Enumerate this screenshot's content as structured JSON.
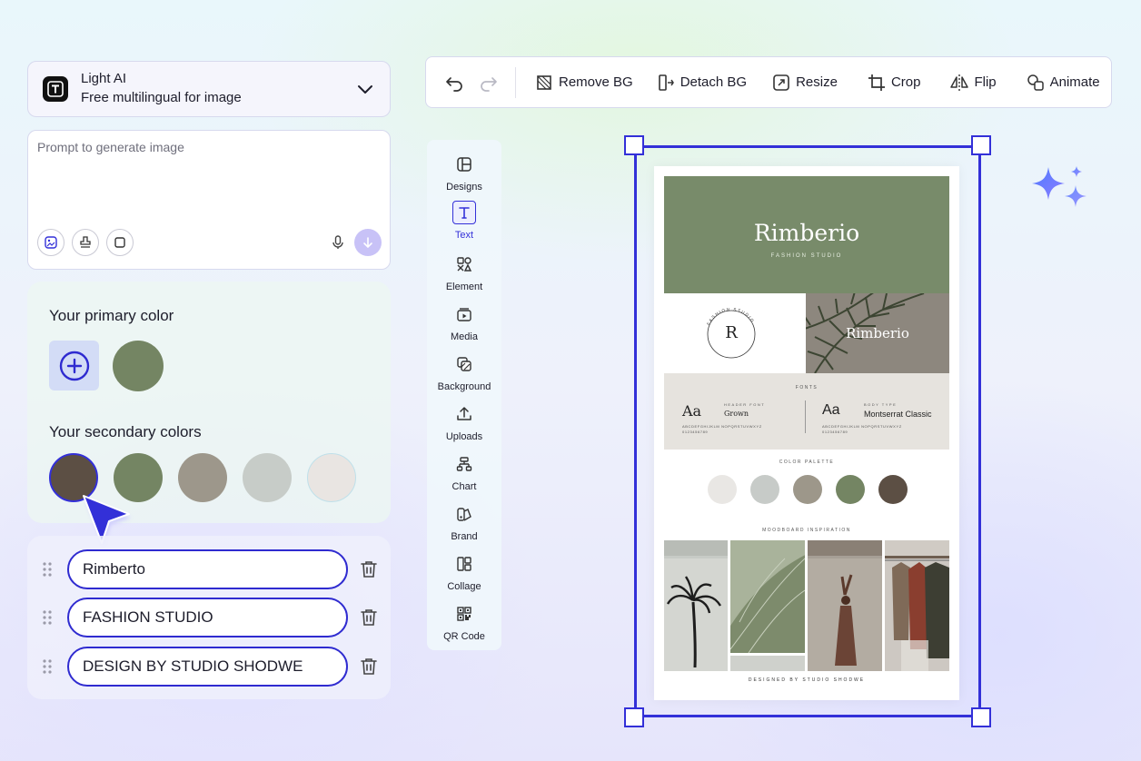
{
  "model": {
    "name": "Light AI",
    "description": "Free multilingual for image"
  },
  "prompt": {
    "placeholder": "Prompt to generate image"
  },
  "colors": {
    "primary_title": "Your primary color",
    "primary": [
      "#748563"
    ],
    "secondary_title": "Your secondary colors",
    "secondary": [
      "#5c4f44",
      "#748563",
      "#9d978b",
      "#c7ccc8",
      "#e9e5e2"
    ]
  },
  "text_fields": [
    {
      "value": "Rimberto"
    },
    {
      "value": "FASHION STUDIO"
    },
    {
      "value": "DESIGN BY STUDIO SHODWE"
    }
  ],
  "toolbar": {
    "remove_bg": "Remove BG",
    "detach_bg": "Detach BG",
    "resize": "Resize",
    "crop": "Crop",
    "flip": "Flip",
    "animate": "Animate"
  },
  "side_menu": {
    "items": [
      {
        "label": "Designs",
        "icon": "layout-icon"
      },
      {
        "label": "Text",
        "icon": "text-icon"
      },
      {
        "label": "Element",
        "icon": "shapes-icon"
      },
      {
        "label": "Media",
        "icon": "media-icon"
      },
      {
        "label": "Background",
        "icon": "background-icon"
      },
      {
        "label": "Uploads",
        "icon": "upload-icon"
      },
      {
        "label": "Chart",
        "icon": "chart-icon"
      },
      {
        "label": "Brand",
        "icon": "brand-icon"
      },
      {
        "label": "Collage",
        "icon": "collage-icon"
      },
      {
        "label": "QR Code",
        "icon": "qr-code-icon"
      }
    ],
    "active": "Text"
  },
  "canvas": {
    "title": "Rimberio",
    "subtitle": "FASHION STUDIO",
    "badge_letter": "R",
    "badge_ring_text": "FASHION STUDIO",
    "palm_title": "Rimberio",
    "fonts_label": "FONTS",
    "font1_sample": "Aa",
    "font1_caption": "HEADER FONT",
    "font1_name": "Grown",
    "font2_sample": "Aa",
    "font2_caption": "BODY TYPE",
    "font2_name": "Montserrat Classic",
    "alphabet": "ABCDEFGHIJKLM NOPQRSTUVWXYZ 0123456789",
    "palette_label": "COLOR PALETTE",
    "palette": [
      "#e9e7e4",
      "#c7cbc8",
      "#9d978a",
      "#748563",
      "#5c4f44"
    ],
    "moodboard_label": "MOODBOARD INSPIRATION",
    "footer": "DESIGNED BY STUDIO SHODWE"
  },
  "accent": "#3330d8"
}
